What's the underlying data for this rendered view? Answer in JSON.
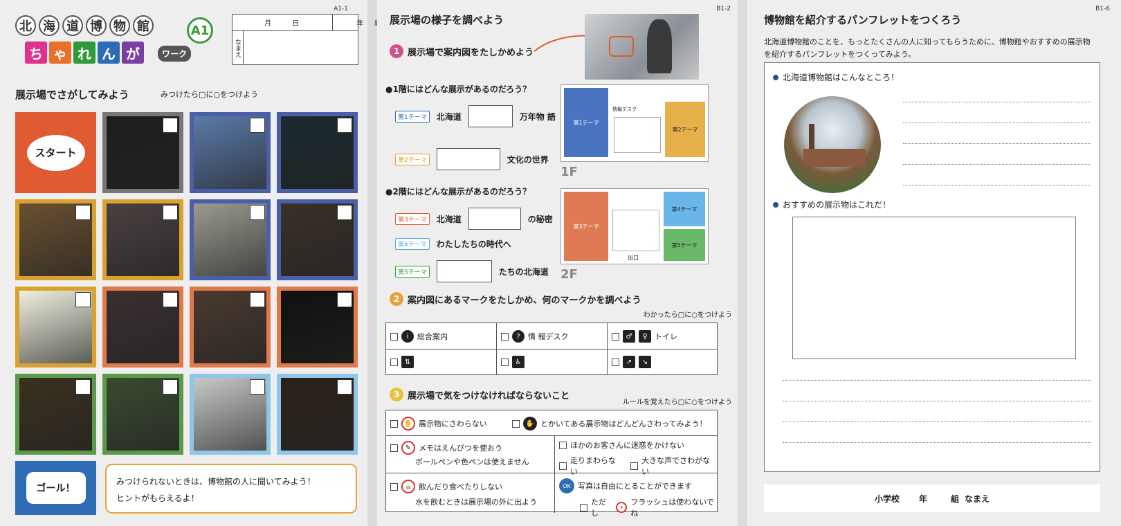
{
  "page1": {
    "code": "A1-1",
    "logo_title": [
      "北",
      "海",
      "道",
      "博",
      "物",
      "館"
    ],
    "logo_sub": [
      "ち",
      "ゃ",
      "れ",
      "ん",
      "が"
    ],
    "logo_sub_colors": [
      "#e0318d",
      "#e8702a",
      "#2f9a3c",
      "#2d6cb5",
      "#7a3fa0"
    ],
    "work": "ワーク",
    "badge": "A1",
    "month": "月",
    "day": "日",
    "year": "年",
    "class": "組",
    "name_label": "なまえ",
    "heading": "展示場でさがしてみよう",
    "instruction": "みつけたら□に○をつけよう",
    "start": "スタート",
    "goal": "ゴール！",
    "hint_line1": "みつけられないときは、博物館の人に聞いてみよう！",
    "hint_line2": "ヒントがもらえるよ！",
    "grid_colors": [
      "#e05a32",
      "#777777",
      "#4a5fa8",
      "#4a5fa8",
      "#d9a230",
      "#d9a230",
      "#4a5fa8",
      "#4a5fa8",
      "#d9a230",
      "#e07a4a",
      "#e07a4a",
      "#e07a4a",
      "#5a9a4a",
      "#5a9a4a",
      "#8ec5e8",
      "#8ec5e8"
    ],
    "photo_colors": [
      "",
      "#1e1e1e",
      "#5a7aa8",
      "#1a2a30",
      "#6a5030",
      "#4a4040",
      "#9a9a90",
      "#3a3028",
      "#f0f0e0",
      "#3a3030",
      "#4a3a30",
      "#101010",
      "#3a3020",
      "#3a4a30",
      "#c8c8c8",
      "#2a2018"
    ]
  },
  "page2": {
    "code": "B1-2",
    "title": "展示場の様子を調べよう",
    "s1": "展示場で案内図をたしかめよう",
    "q1": "●1階にはどんな展示があるのだろう？",
    "t1": "第1テーマ",
    "t1a": "北海道",
    "t1b": "万年物 語",
    "t2": "第2テーマ",
    "t2b": "文化の世界",
    "q2": "●2階にはどんな展示があるのだろう？",
    "t3": "第3テーマ",
    "t3a": "北海道",
    "t3b": "の秘密",
    "t4": "第4テーマ",
    "t4a": "わたしたちの時代へ",
    "t5": "第5テーマ",
    "t5b": "たちの北海道",
    "floor1": "1F",
    "floor2": "2F",
    "map_t1": "第1テーマ",
    "map_t2": "第2テーマ",
    "map_t3": "第3テーマ",
    "map_t4": "第4テーマ",
    "map_t5": "第5テーマ",
    "map_desk": "情報デスク",
    "map_exit": "出口",
    "s2": "案内図にあるマークをたしかめ、何のマークかを調べよう",
    "s2_note": "わかったら□に○をつけよう",
    "m1": "総合案内",
    "m2": "情 報デスク",
    "m3": "トイレ",
    "s3": "展示場で気をつけなければならないこと",
    "s3_note": "ルールを覚えたら□に○をつけよう",
    "r1": "展示物にさわらない",
    "r2": "とかいてある展示物はどんどんさわってみよう！",
    "r3a": "メモはえんぴつを使おう",
    "r3b": "ボールペンや色ペンは使えません",
    "r4a": "ほかのお客さんに迷惑をかけない",
    "r4b": "走りまわらない",
    "r4c": "大きな声でさわがない",
    "r5a": "飲んだり食べたりしない",
    "r5b": "水を飲むときは展示場の外に出よう",
    "r6a": "写真は自由にとることができます",
    "r6b": "ただし",
    "r6c": "フラッシュは使わないでね",
    "icon_ok": "OK"
  },
  "page3": {
    "code": "B1-6",
    "title": "博物館を紹介するパンフレットをつくろう",
    "intro1": "北海道博物館のことを、もっとたくさんの人に知ってもらうために、博物館やおすすめの展示物",
    "intro2": "を紹介するパンフレットをつくってみよう。",
    "h1": "北海道博物館はこんなところ！",
    "h2": "おすすめの展示物はこれだ！",
    "school": "小学校",
    "year": "年",
    "class": "組",
    "name": "なまえ"
  }
}
